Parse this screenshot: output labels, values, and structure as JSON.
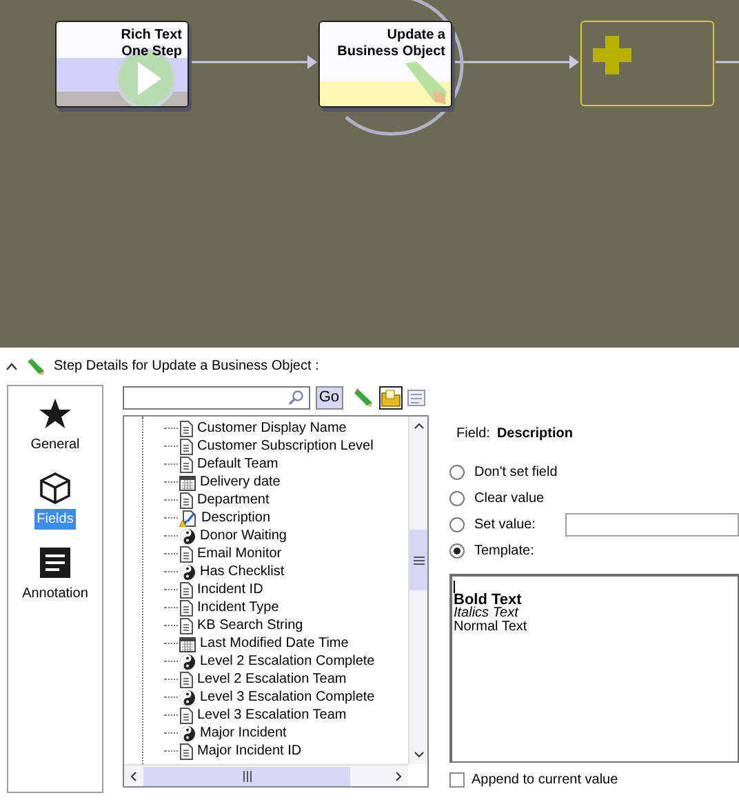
{
  "canvas": {
    "nodes": [
      {
        "kind": "play",
        "title": "Rich Text One Step",
        "selected": false
      },
      {
        "kind": "pencil",
        "title": "Update a Business Object",
        "selected": true
      },
      {
        "kind": "add",
        "selected": false
      }
    ]
  },
  "details": {
    "title": "Step Details for Update a Business Object :",
    "expanded": true
  },
  "nav": [
    {
      "kind": "star",
      "label": "General",
      "selected": false
    },
    {
      "kind": "cube",
      "label": "Fields",
      "selected": true
    },
    {
      "kind": "doc",
      "label": "Annotation",
      "selected": false
    }
  ],
  "search": {
    "button": "Go"
  },
  "toolbar": [
    {
      "kind": "pencil",
      "selected": false
    },
    {
      "kind": "folder",
      "selected": true
    },
    {
      "kind": "list",
      "selected": false
    }
  ],
  "tree": [
    {
      "kind": "doc",
      "label": "Customer Display Name"
    },
    {
      "kind": "doc",
      "label": "Customer Subscription Level"
    },
    {
      "kind": "doc",
      "label": "Default Team"
    },
    {
      "kind": "calendar",
      "label": "Delivery date"
    },
    {
      "kind": "doc",
      "label": "Department"
    },
    {
      "kind": "warn",
      "label": "Description"
    },
    {
      "kind": "bool",
      "label": "Donor Waiting"
    },
    {
      "kind": "doc",
      "label": "Email Monitor"
    },
    {
      "kind": "bool",
      "label": "Has Checklist"
    },
    {
      "kind": "doc",
      "label": "Incident ID"
    },
    {
      "kind": "doc",
      "label": "Incident Type"
    },
    {
      "kind": "doc",
      "label": "KB Search String"
    },
    {
      "kind": "calendar",
      "label": "Last Modified Date Time"
    },
    {
      "kind": "bool",
      "label": "Level 2 Escalation Complete"
    },
    {
      "kind": "doc",
      "label": "Level 2 Escalation Team"
    },
    {
      "kind": "bool",
      "label": "Level 3 Escalation Complete"
    },
    {
      "kind": "doc",
      "label": "Level 3 Escalation Team"
    },
    {
      "kind": "bool",
      "label": "Major Incident"
    },
    {
      "kind": "doc",
      "label": "Major Incident ID"
    }
  ],
  "field": {
    "label": "Field:",
    "value": "Description"
  },
  "options": [
    {
      "label": "Don't set field",
      "selected": false
    },
    {
      "label": "Clear value",
      "selected": false
    },
    {
      "label": "Set value:",
      "selected": false,
      "kind": "input"
    },
    {
      "label": "Template:",
      "selected": true
    }
  ],
  "template": [
    {
      "kind": "bold",
      "text": "Bold Text"
    },
    {
      "kind": "italic",
      "text": "Italics Text"
    },
    {
      "kind": "normal",
      "text": "Normal Text"
    }
  ],
  "append": {
    "label": "Append to current value",
    "checked": false
  }
}
